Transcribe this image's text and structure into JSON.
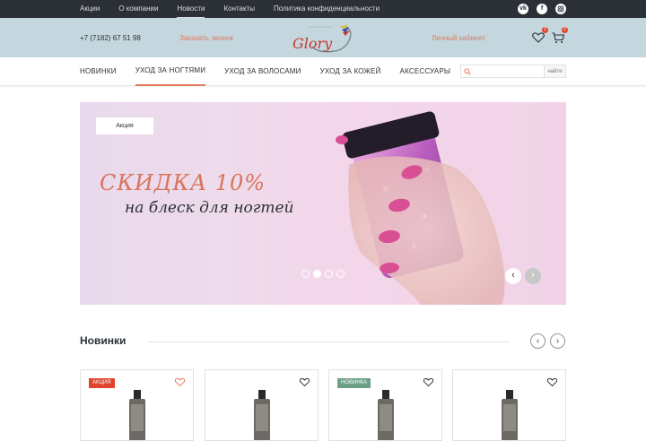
{
  "topnav": {
    "items": [
      {
        "label": "Акции"
      },
      {
        "label": "О компании"
      },
      {
        "label": "Новости"
      },
      {
        "label": "Контакты"
      },
      {
        "label": "Политика конфиденциальности"
      }
    ],
    "socials": [
      "vk-icon",
      "facebook-icon",
      "instagram-icon"
    ]
  },
  "header": {
    "phone": "+7 (7182) 67 51 98",
    "callback": "Заказать звонок",
    "logo_text": "Glory",
    "cabinet": "Личный кабинет",
    "wishlist_count": "2",
    "cart_count": "2"
  },
  "catnav": {
    "items": [
      {
        "label": "НОВИНКИ"
      },
      {
        "label": "УХОД ЗА НОГТЯМИ"
      },
      {
        "label": "УХОД ЗА ВОЛОСАМИ"
      },
      {
        "label": "УХОД ЗА КОЖЕЙ"
      },
      {
        "label": "АКСЕССУАРЫ"
      }
    ],
    "search": {
      "placeholder": "",
      "button": "найти"
    }
  },
  "banner": {
    "tag": "Акция",
    "headline": "СКИДКА 10%",
    "subline": "на блеск для ногтей",
    "slide_count": 4,
    "active_slide": 2
  },
  "new_section": {
    "title": "Новинки",
    "products": [
      {
        "tag": "АКЦИЯ"
      },
      {
        "tag": ""
      },
      {
        "tag": "НОВИНКА"
      },
      {
        "tag": ""
      }
    ]
  },
  "colors": {
    "topbar": "#2b2f36",
    "header": "#c4d6de",
    "accent": "#e47a5c",
    "sale_tag": "#e0442f",
    "new_tag": "#6a9f86"
  }
}
